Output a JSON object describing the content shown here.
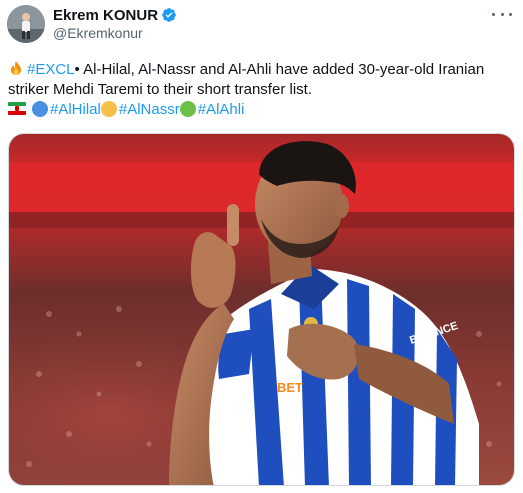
{
  "author": {
    "display_name": "Ekrem KONUR",
    "handle": "@Ekremkonur",
    "verified": true,
    "avatar_icon": "profile-avatar"
  },
  "tweet": {
    "line1": {
      "emoji": "fire-emoji",
      "hashtag": "#EXCL",
      "text": "• Al-Hilal, Al-Nassr and Al-Ahli have added 30-year-old Iranian"
    },
    "line2": "striker Mehdi Taremi to their short transfer list.",
    "line3": {
      "flag": "iran-flag",
      "tags": [
        {
          "circle_color": "#4a90e2",
          "label": "#AlHilal"
        },
        {
          "circle_color": "#f5c04a",
          "label": "#AlNassr"
        },
        {
          "circle_color": "#6cc04a",
          "label": "#AlAhli"
        }
      ]
    }
  },
  "media": {
    "sponsor_text": "BINANCE",
    "shirt_text": "BET",
    "accent_colors": {
      "stripe_blue": "#1f4fbf",
      "stand_red": "#d81f26"
    }
  },
  "colors": {
    "link": "#1d9bf0",
    "muted": "#536471",
    "verified": "#1d9bf0"
  }
}
